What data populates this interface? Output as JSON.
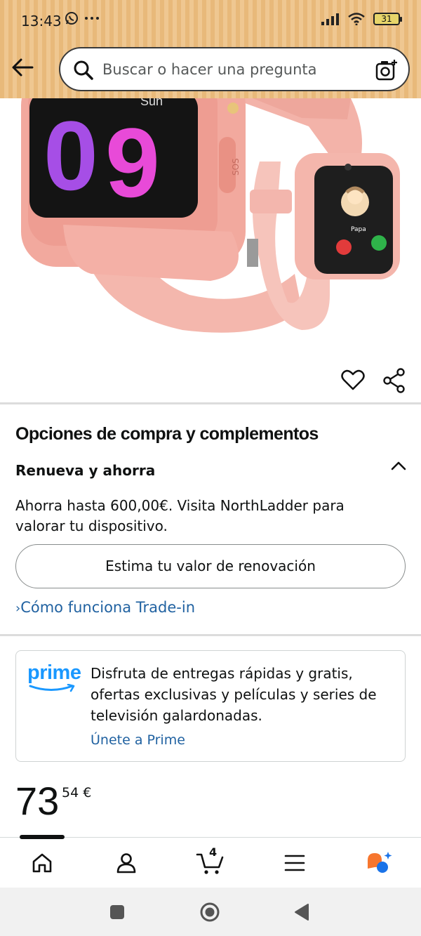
{
  "status_bar": {
    "time": "13:43",
    "battery": "31",
    "icons": [
      "whatsapp-icon",
      "more-icon",
      "signal-icon",
      "wifi-icon",
      "battery-icon"
    ]
  },
  "search": {
    "placeholder": "Buscar o hacer una pregunta"
  },
  "product": {
    "image_icons": [
      "favorite-icon",
      "share-icon"
    ]
  },
  "buying_options": {
    "title": "Opciones de compra y complementos",
    "renew_title": "Renueva y ahorra",
    "renew_description": "Ahorra hasta 600,00€. Visita NorthLadder para valorar tu dispositivo.",
    "estimate_button": "Estima tu valor de renovación",
    "tradein_link": "Cómo funciona Trade-in"
  },
  "prime": {
    "logo_text": "prime",
    "description": "Disfruta de entregas rápidas y gratis, ofertas exclusivas y películas y series de televisión galardonadas.",
    "join_link": "Únete a Prime"
  },
  "price": {
    "whole": "73",
    "fraction_currency": "54 €"
  },
  "bottom_nav": {
    "cart_count": "4",
    "items": [
      "home-icon",
      "account-icon",
      "cart-icon",
      "menu-icon",
      "rufus-icon"
    ]
  },
  "colors": {
    "header_bg": "#e8b97a",
    "link": "#2162a1",
    "prime_blue": "#1a98ff"
  }
}
